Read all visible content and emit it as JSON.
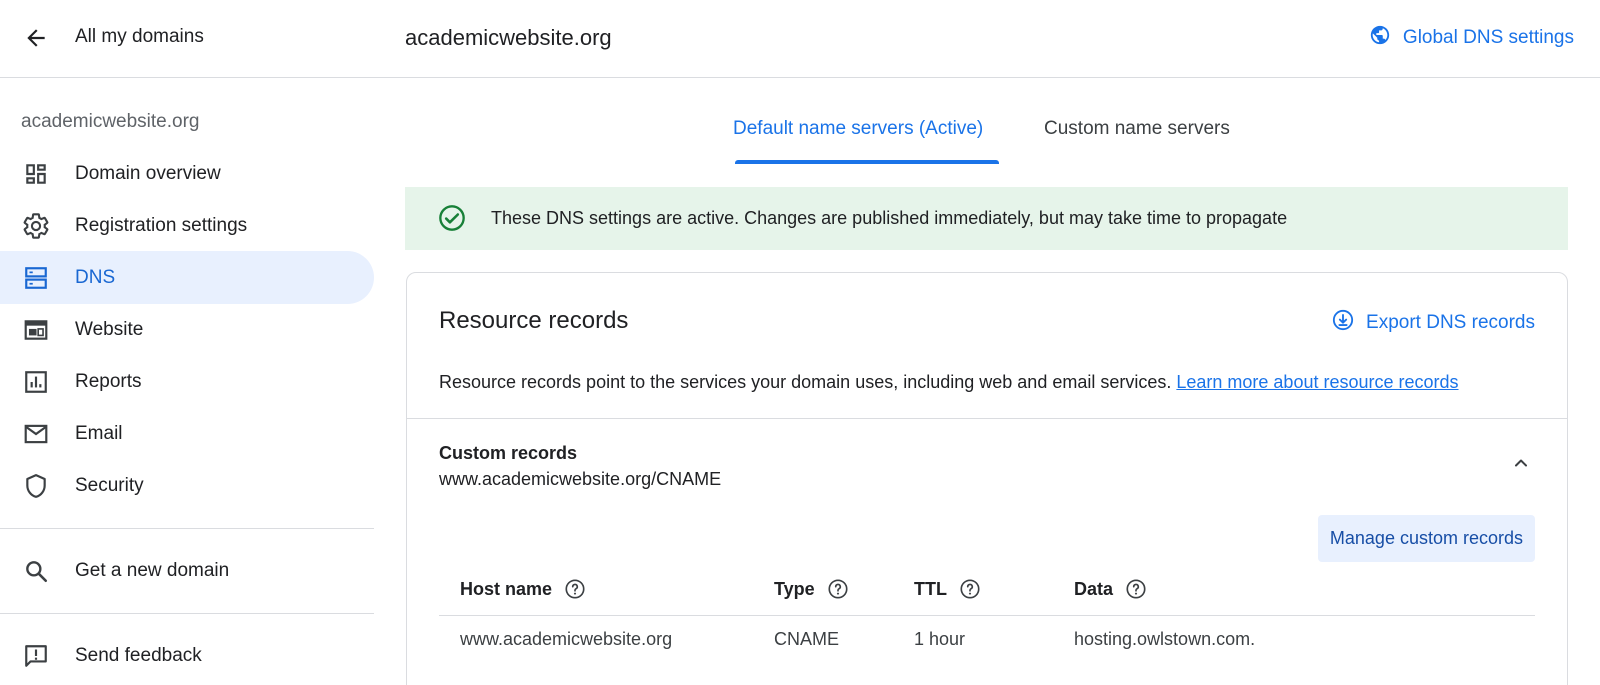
{
  "header": {
    "back_label": "All my domains",
    "domain_title": "academicwebsite.org",
    "global_dns_label": "Global DNS settings"
  },
  "sidebar": {
    "domain": "academicwebsite.org",
    "items": [
      {
        "label": "Domain overview",
        "icon": "dashboard-icon"
      },
      {
        "label": "Registration settings",
        "icon": "gear-icon"
      },
      {
        "label": "DNS",
        "icon": "dns-icon",
        "active": true
      },
      {
        "label": "Website",
        "icon": "website-icon"
      },
      {
        "label": "Reports",
        "icon": "reports-icon"
      },
      {
        "label": "Email",
        "icon": "email-icon"
      },
      {
        "label": "Security",
        "icon": "shield-icon"
      }
    ],
    "get_new_domain": "Get a new domain",
    "send_feedback": "Send feedback"
  },
  "tabs": {
    "active": "Default name servers (Active)",
    "inactive": "Custom name servers"
  },
  "banner": {
    "text": "These DNS settings are active. Changes are published immediately, but may take time to propagate"
  },
  "card": {
    "title": "Resource records",
    "export_label": "Export DNS records",
    "description": "Resource records point to the services your domain uses, including web and email services.",
    "learn_more": "Learn more about resource records",
    "custom_title": "Custom records",
    "custom_subtitle": "www.academicwebsite.org/CNAME",
    "manage_label": "Manage custom records"
  },
  "table": {
    "headers": {
      "host": "Host name",
      "type": "Type",
      "ttl": "TTL",
      "data": "Data"
    },
    "rows": [
      {
        "host": "www.academicwebsite.org",
        "type": "CNAME",
        "ttl": "1 hour",
        "data": "hosting.owlstown.com."
      }
    ]
  },
  "colors": {
    "accent": "#1a73e8",
    "active_nav_bg": "#e8f0fe",
    "success_bg": "#e6f4ea",
    "success_icon": "#188038"
  }
}
